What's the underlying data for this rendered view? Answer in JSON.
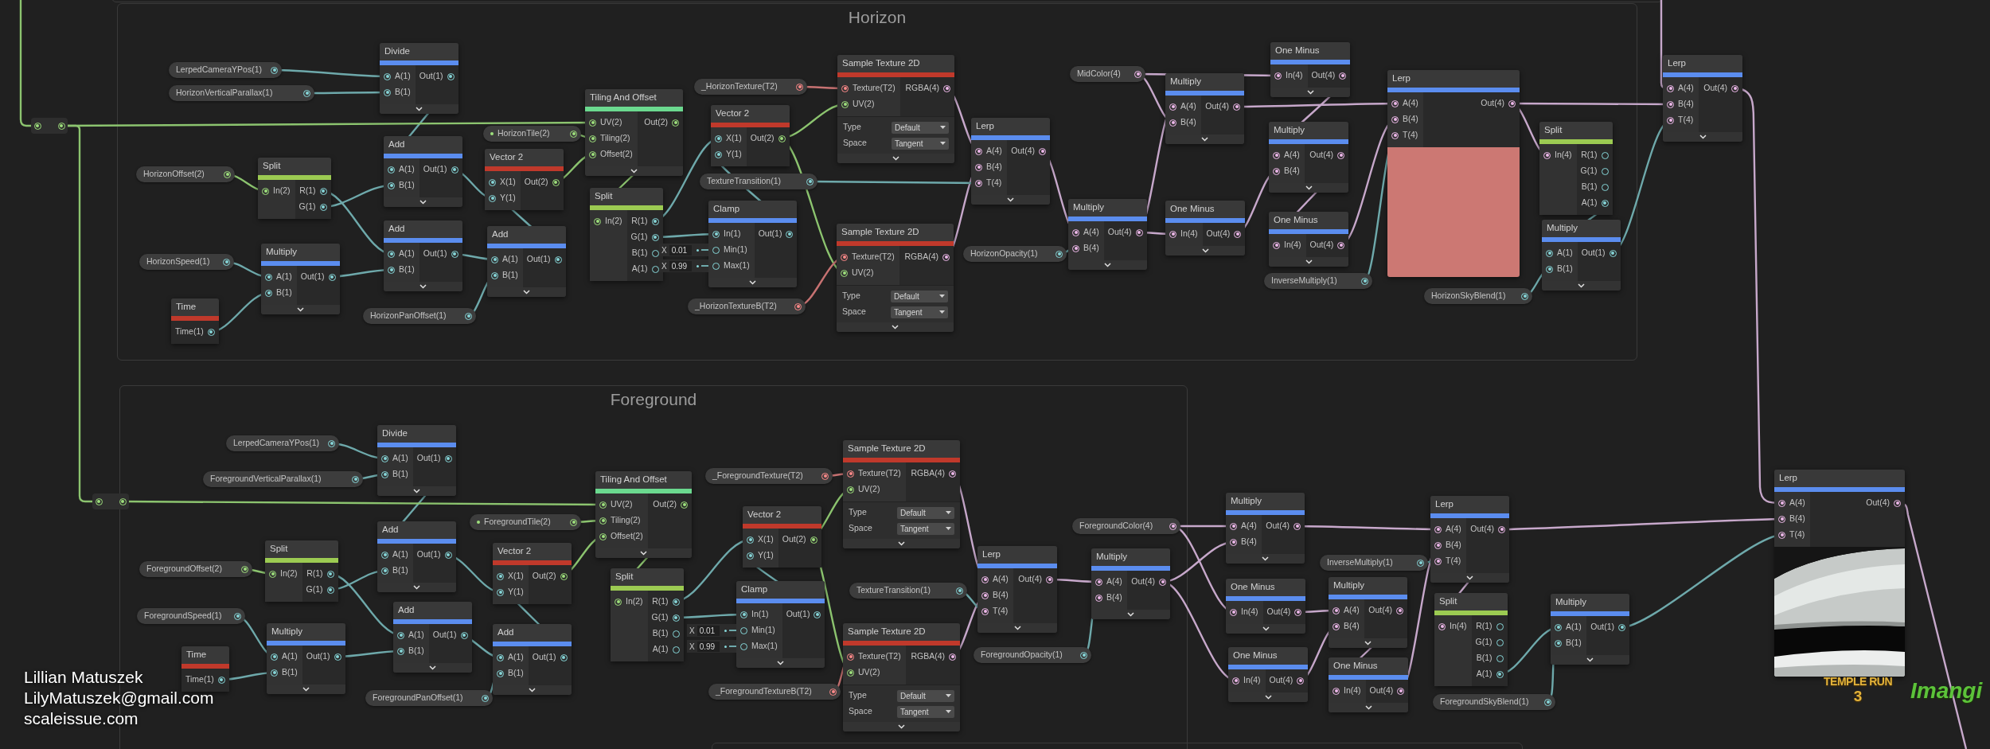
{
  "groups": [
    {
      "title": "Horizon"
    },
    {
      "title": "Foreground"
    }
  ],
  "properties": [
    {
      "label": "LerpedCameraYPos(1)",
      "kind": "float",
      "pinned": false
    },
    {
      "label": "HorizonVerticalParallax(1)",
      "kind": "float",
      "pinned": false
    },
    {
      "label": "HorizonOffset(2)",
      "kind": "vector2",
      "pinned": false
    },
    {
      "label": "HorizonSpeed(1)",
      "kind": "float",
      "pinned": false
    },
    {
      "label": "HorizonTile(2)",
      "kind": "vector2",
      "pinned": true
    },
    {
      "label": "HorizonPanOffset(1)",
      "kind": "float",
      "pinned": false
    },
    {
      "label": "_HorizonTexture(T2)",
      "kind": "texture",
      "pinned": false
    },
    {
      "label": "TextureTransition(1)",
      "kind": "float",
      "pinned": false
    },
    {
      "label": "_HorizonTextureB(T2)",
      "kind": "texture",
      "pinned": false
    },
    {
      "label": "HorizonOpacity(1)",
      "kind": "float",
      "pinned": false
    },
    {
      "label": "MidColor(4)",
      "kind": "vector4",
      "pinned": false
    },
    {
      "label": "InverseMultiply(1)",
      "kind": "float",
      "pinned": false
    },
    {
      "label": "HorizonSkyBlend(1)",
      "kind": "float",
      "pinned": false
    },
    {
      "label": "LerpedCameraYPos(1)",
      "kind": "float",
      "pinned": false
    },
    {
      "label": "ForegroundVerticalParallax(1)",
      "kind": "float",
      "pinned": false
    },
    {
      "label": "ForegroundOffset(2)",
      "kind": "vector2",
      "pinned": false
    },
    {
      "label": "ForegroundSpeed(1)",
      "kind": "float",
      "pinned": false
    },
    {
      "label": "ForegroundTile(2)",
      "kind": "vector2",
      "pinned": true
    },
    {
      "label": "ForegroundPanOffset(1)",
      "kind": "float",
      "pinned": false
    },
    {
      "label": "_ForegroundTexture(T2)",
      "kind": "texture",
      "pinned": false
    },
    {
      "label": "TextureTransition(1)",
      "kind": "float",
      "pinned": false
    },
    {
      "label": "_ForegroundTextureB(T2)",
      "kind": "texture",
      "pinned": false
    },
    {
      "label": "ForegroundOpacity(1)",
      "kind": "float",
      "pinned": false
    },
    {
      "label": "ForegroundColor(4)",
      "kind": "vector4",
      "pinned": false
    },
    {
      "label": "InverseMultiply(1)",
      "kind": "float",
      "pinned": false
    },
    {
      "label": "ForegroundSkyBlend(1)",
      "kind": "float",
      "pinned": false
    }
  ],
  "nodes": [
    {
      "title": "Divide",
      "color": "#5b8def",
      "collapsible": true,
      "inputs": [
        {
          "label": "A(1)",
          "kind": "float",
          "connected": true
        },
        {
          "label": "B(1)",
          "kind": "float",
          "connected": true
        }
      ],
      "outputs": [
        {
          "label": "Out(1)",
          "kind": "float",
          "connected": true
        }
      ]
    },
    {
      "title": "Tiling And Offset",
      "color": "#6bd98f",
      "collapsible": true,
      "inputs": [
        {
          "label": "UV(2)",
          "kind": "vector2",
          "connected": true
        },
        {
          "label": "Tiling(2)",
          "kind": "vector2",
          "connected": true
        },
        {
          "label": "Offset(2)",
          "kind": "vector2",
          "connected": true
        }
      ],
      "outputs": [
        {
          "label": "Out(2)",
          "kind": "vector2",
          "connected": true
        }
      ]
    },
    {
      "title": "Split",
      "color": "#9ccb52",
      "collapsible": false,
      "inputs": [
        {
          "label": "In(2)",
          "kind": "vector2",
          "connected": true
        }
      ],
      "outputs": [
        {
          "label": "R(1)",
          "kind": "float",
          "connected": true
        },
        {
          "label": "G(1)",
          "kind": "float",
          "connected": true
        }
      ]
    },
    {
      "title": "Add",
      "color": "#5b8def",
      "collapsible": true,
      "inputs": [
        {
          "label": "A(1)",
          "kind": "float",
          "connected": true
        },
        {
          "label": "B(1)",
          "kind": "float",
          "connected": true
        }
      ],
      "outputs": [
        {
          "label": "Out(1)",
          "kind": "float",
          "connected": true
        }
      ]
    },
    {
      "title": "Vector 2",
      "color": "#c0392b",
      "collapsible": false,
      "inputs": [
        {
          "label": "X(1)",
          "kind": "float",
          "connected": true
        },
        {
          "label": "Y(1)",
          "kind": "float",
          "connected": true
        }
      ],
      "outputs": [
        {
          "label": "Out(2)",
          "kind": "vector2",
          "connected": true
        }
      ]
    },
    {
      "title": "Add",
      "color": "#5b8def",
      "collapsible": true,
      "inputs": [
        {
          "label": "A(1)",
          "kind": "float",
          "connected": true
        },
        {
          "label": "B(1)",
          "kind": "float",
          "connected": true
        }
      ],
      "outputs": [
        {
          "label": "Out(1)",
          "kind": "float",
          "connected": true
        }
      ]
    },
    {
      "title": "Add",
      "color": "#5b8def",
      "collapsible": true,
      "inputs": [
        {
          "label": "A(1)",
          "kind": "float",
          "connected": true
        },
        {
          "label": "B(1)",
          "kind": "float",
          "connected": true
        }
      ],
      "outputs": [
        {
          "label": "Out(1)",
          "kind": "float",
          "connected": true
        }
      ]
    },
    {
      "title": "Multiply",
      "color": "#5b8def",
      "collapsible": true,
      "inputs": [
        {
          "label": "A(1)",
          "kind": "float",
          "connected": true
        },
        {
          "label": "B(1)",
          "kind": "float",
          "connected": true
        }
      ],
      "outputs": [
        {
          "label": "Out(1)",
          "kind": "float",
          "connected": true
        }
      ]
    },
    {
      "title": "Time",
      "color": "#c0392b",
      "collapsible": false,
      "outputs": [
        {
          "label": "Time(1)",
          "kind": "float",
          "connected": true
        }
      ]
    },
    {
      "title": "Split",
      "color": "#9ccb52",
      "collapsible": false,
      "inputs": [
        {
          "label": "In(2)",
          "kind": "vector2",
          "connected": true
        }
      ],
      "outputs": [
        {
          "label": "R(1)",
          "kind": "float",
          "connected": true
        },
        {
          "label": "G(1)",
          "kind": "float",
          "connected": true
        },
        {
          "label": "B(1)",
          "kind": "float",
          "connected": false
        },
        {
          "label": "A(1)",
          "kind": "float",
          "connected": false
        }
      ]
    },
    {
      "title": "Vector 2",
      "color": "#c0392b",
      "collapsible": false,
      "inputs": [
        {
          "label": "X(1)",
          "kind": "float",
          "connected": true
        },
        {
          "label": "Y(1)",
          "kind": "float",
          "connected": true
        }
      ],
      "outputs": [
        {
          "label": "Out(2)",
          "kind": "vector2",
          "connected": true
        }
      ]
    },
    {
      "title": "Clamp",
      "color": "#5b8def",
      "collapsible": true,
      "inputs": [
        {
          "label": "In(1)",
          "kind": "float",
          "connected": true
        },
        {
          "label": "Min(1)",
          "kind": "float",
          "connected": false,
          "field": {
            "axis": "X",
            "value": "0.01"
          }
        },
        {
          "label": "Max(1)",
          "kind": "float",
          "connected": false,
          "field": {
            "axis": "X",
            "value": "0.99"
          }
        }
      ],
      "outputs": [
        {
          "label": "Out(1)",
          "kind": "float",
          "connected": true
        }
      ]
    },
    {
      "title": "Sample Texture 2D",
      "color": "#c0392b",
      "collapsible": true,
      "inputs": [
        {
          "label": "Texture(T2)",
          "kind": "texture",
          "connected": true
        },
        {
          "label": "UV(2)",
          "kind": "vector2",
          "connected": true
        }
      ],
      "outputs": [
        {
          "label": "RGBA(4)",
          "kind": "vector4",
          "connected": true
        }
      ],
      "controls": [
        {
          "label": "Type",
          "value": "Default"
        },
        {
          "label": "Space",
          "value": "Tangent"
        }
      ]
    },
    {
      "title": "Sample Texture 2D",
      "color": "#c0392b",
      "collapsible": true,
      "inputs": [
        {
          "label": "Texture(T2)",
          "kind": "texture",
          "connected": true
        },
        {
          "label": "UV(2)",
          "kind": "vector2",
          "connected": true
        }
      ],
      "outputs": [
        {
          "label": "RGBA(4)",
          "kind": "vector4",
          "connected": true
        }
      ],
      "controls": [
        {
          "label": "Type",
          "value": "Default"
        },
        {
          "label": "Space",
          "value": "Tangent"
        }
      ]
    },
    {
      "title": "Lerp",
      "color": "#5b8def",
      "collapsible": true,
      "inputs": [
        {
          "label": "A(4)",
          "kind": "vector4",
          "connected": true
        },
        {
          "label": "B(4)",
          "kind": "vector4",
          "connected": true
        },
        {
          "label": "T(4)",
          "kind": "vector4",
          "connected": true
        }
      ],
      "outputs": [
        {
          "label": "Out(4)",
          "kind": "vector4",
          "connected": true
        }
      ]
    },
    {
      "title": "Multiply",
      "color": "#5b8def",
      "collapsible": true,
      "inputs": [
        {
          "label": "A(4)",
          "kind": "vector4",
          "connected": true
        },
        {
          "label": "B(4)",
          "kind": "vector4",
          "connected": true
        }
      ],
      "outputs": [
        {
          "label": "Out(4)",
          "kind": "vector4",
          "connected": true
        }
      ]
    },
    {
      "title": "Multiply",
      "color": "#5b8def",
      "collapsible": true,
      "inputs": [
        {
          "label": "A(4)",
          "kind": "vector4",
          "connected": true
        },
        {
          "label": "B(4)",
          "kind": "vector4",
          "connected": true
        }
      ],
      "outputs": [
        {
          "label": "Out(4)",
          "kind": "vector4",
          "connected": true
        }
      ]
    },
    {
      "title": "One Minus",
      "color": "#5b8def",
      "collapsible": true,
      "inputs": [
        {
          "label": "In(4)",
          "kind": "vector4",
          "connected": true
        }
      ],
      "outputs": [
        {
          "label": "Out(4)",
          "kind": "vector4",
          "connected": true
        }
      ]
    },
    {
      "title": "Multiply",
      "color": "#5b8def",
      "collapsible": true,
      "inputs": [
        {
          "label": "A(4)",
          "kind": "vector4",
          "connected": true
        },
        {
          "label": "B(4)",
          "kind": "vector4",
          "connected": true
        }
      ],
      "outputs": [
        {
          "label": "Out(4)",
          "kind": "vector4",
          "connected": true
        }
      ]
    },
    {
      "title": "One Minus",
      "color": "#5b8def",
      "collapsible": true,
      "inputs": [
        {
          "label": "In(4)",
          "kind": "vector4",
          "connected": true
        }
      ],
      "outputs": [
        {
          "label": "Out(4)",
          "kind": "vector4",
          "connected": true
        }
      ]
    },
    {
      "title": "One Minus",
      "color": "#5b8def",
      "collapsible": true,
      "inputs": [
        {
          "label": "In(4)",
          "kind": "vector4",
          "connected": true
        }
      ],
      "outputs": [
        {
          "label": "Out(4)",
          "kind": "vector4",
          "connected": true
        }
      ]
    },
    {
      "title": "Lerp",
      "color": "#5b8def",
      "collapsible": false,
      "inputs": [
        {
          "label": "A(4)",
          "kind": "vector4",
          "connected": true
        },
        {
          "label": "B(4)",
          "kind": "vector4",
          "connected": true
        },
        {
          "label": "T(4)",
          "kind": "vector4",
          "connected": true
        }
      ],
      "outputs": [
        {
          "label": "Out(4)",
          "kind": "vector4",
          "connected": true
        }
      ],
      "preview": {
        "kind": "swatch",
        "color": "#cc7873"
      }
    },
    {
      "title": "Split",
      "color": "#9ccb52",
      "collapsible": false,
      "inputs": [
        {
          "label": "In(4)",
          "kind": "vector4",
          "connected": true
        }
      ],
      "outputs": [
        {
          "label": "R(1)",
          "kind": "float",
          "connected": false
        },
        {
          "label": "G(1)",
          "kind": "float",
          "connected": false
        },
        {
          "label": "B(1)",
          "kind": "float",
          "connected": false
        },
        {
          "label": "A(1)",
          "kind": "float",
          "connected": true
        }
      ]
    },
    {
      "title": "Multiply",
      "color": "#5b8def",
      "collapsible": true,
      "inputs": [
        {
          "label": "A(1)",
          "kind": "float",
          "connected": true
        },
        {
          "label": "B(1)",
          "kind": "float",
          "connected": true
        }
      ],
      "outputs": [
        {
          "label": "Out(1)",
          "kind": "float",
          "connected": true
        }
      ]
    },
    {
      "title": "Lerp",
      "color": "#5b8def",
      "collapsible": true,
      "inputs": [
        {
          "label": "A(4)",
          "kind": "vector4",
          "connected": true
        },
        {
          "label": "B(4)",
          "kind": "vector4",
          "connected": true
        },
        {
          "label": "T(4)",
          "kind": "vector4",
          "connected": true
        }
      ],
      "outputs": [
        {
          "label": "Out(4)",
          "kind": "vector4",
          "connected": true
        }
      ]
    },
    {
      "title": "Divide",
      "color": "#5b8def",
      "collapsible": true,
      "inputs": [
        {
          "label": "A(1)",
          "kind": "float",
          "connected": true
        },
        {
          "label": "B(1)",
          "kind": "float",
          "connected": true
        }
      ],
      "outputs": [
        {
          "label": "Out(1)",
          "kind": "float",
          "connected": true
        }
      ]
    },
    {
      "title": "Tiling And Offset",
      "color": "#6bd98f",
      "collapsible": true,
      "inputs": [
        {
          "label": "UV(2)",
          "kind": "vector2",
          "connected": true
        },
        {
          "label": "Tiling(2)",
          "kind": "vector2",
          "connected": true
        },
        {
          "label": "Offset(2)",
          "kind": "vector2",
          "connected": true
        }
      ],
      "outputs": [
        {
          "label": "Out(2)",
          "kind": "vector2",
          "connected": true
        }
      ]
    },
    {
      "title": "Split",
      "color": "#9ccb52",
      "collapsible": false,
      "inputs": [
        {
          "label": "In(2)",
          "kind": "vector2",
          "connected": true
        }
      ],
      "outputs": [
        {
          "label": "R(1)",
          "kind": "float",
          "connected": true
        },
        {
          "label": "G(1)",
          "kind": "float",
          "connected": true
        }
      ]
    },
    {
      "title": "Add",
      "color": "#5b8def",
      "collapsible": true,
      "inputs": [
        {
          "label": "A(1)",
          "kind": "float",
          "connected": true
        },
        {
          "label": "B(1)",
          "kind": "float",
          "connected": true
        }
      ],
      "outputs": [
        {
          "label": "Out(1)",
          "kind": "float",
          "connected": true
        }
      ]
    },
    {
      "title": "Vector 2",
      "color": "#c0392b",
      "collapsible": false,
      "inputs": [
        {
          "label": "X(1)",
          "kind": "float",
          "connected": true
        },
        {
          "label": "Y(1)",
          "kind": "float",
          "connected": true
        }
      ],
      "outputs": [
        {
          "label": "Out(2)",
          "kind": "vector2",
          "connected": true
        }
      ]
    },
    {
      "title": "Add",
      "color": "#5b8def",
      "collapsible": true,
      "inputs": [
        {
          "label": "A(1)",
          "kind": "float",
          "connected": true
        },
        {
          "label": "B(1)",
          "kind": "float",
          "connected": true
        }
      ],
      "outputs": [
        {
          "label": "Out(1)",
          "kind": "float",
          "connected": true
        }
      ]
    },
    {
      "title": "Multiply",
      "color": "#5b8def",
      "collapsible": true,
      "inputs": [
        {
          "label": "A(1)",
          "kind": "float",
          "connected": true
        },
        {
          "label": "B(1)",
          "kind": "float",
          "connected": true
        }
      ],
      "outputs": [
        {
          "label": "Out(1)",
          "kind": "float",
          "connected": true
        }
      ]
    },
    {
      "title": "Add",
      "color": "#5b8def",
      "collapsible": true,
      "inputs": [
        {
          "label": "A(1)",
          "kind": "float",
          "connected": true
        },
        {
          "label": "B(1)",
          "kind": "float",
          "connected": true
        }
      ],
      "outputs": [
        {
          "label": "Out(1)",
          "kind": "float",
          "connected": true
        }
      ]
    },
    {
      "title": "Time",
      "color": "#c0392b",
      "collapsible": false,
      "outputs": [
        {
          "label": "Time(1)",
          "kind": "float",
          "connected": true
        }
      ]
    },
    {
      "title": "Split",
      "color": "#9ccb52",
      "collapsible": false,
      "inputs": [
        {
          "label": "In(2)",
          "kind": "vector2",
          "connected": true
        }
      ],
      "outputs": [
        {
          "label": "R(1)",
          "kind": "float",
          "connected": true
        },
        {
          "label": "G(1)",
          "kind": "float",
          "connected": true
        },
        {
          "label": "B(1)",
          "kind": "float",
          "connected": false
        },
        {
          "label": "A(1)",
          "kind": "float",
          "connected": false
        }
      ]
    },
    {
      "title": "Vector 2",
      "color": "#c0392b",
      "collapsible": false,
      "inputs": [
        {
          "label": "X(1)",
          "kind": "float",
          "connected": true
        },
        {
          "label": "Y(1)",
          "kind": "float",
          "connected": true
        }
      ],
      "outputs": [
        {
          "label": "Out(2)",
          "kind": "vector2",
          "connected": true
        }
      ]
    },
    {
      "title": "Clamp",
      "color": "#5b8def",
      "collapsible": true,
      "inputs": [
        {
          "label": "In(1)",
          "kind": "float",
          "connected": true
        },
        {
          "label": "Min(1)",
          "kind": "float",
          "connected": false,
          "field": {
            "axis": "X",
            "value": "0.01"
          }
        },
        {
          "label": "Max(1)",
          "kind": "float",
          "connected": false,
          "field": {
            "axis": "X",
            "value": "0.99"
          }
        }
      ],
      "outputs": [
        {
          "label": "Out(1)",
          "kind": "float",
          "connected": true
        }
      ]
    },
    {
      "title": "Sample Texture 2D",
      "color": "#c0392b",
      "collapsible": true,
      "inputs": [
        {
          "label": "Texture(T2)",
          "kind": "texture",
          "connected": true
        },
        {
          "label": "UV(2)",
          "kind": "vector2",
          "connected": true
        }
      ],
      "outputs": [
        {
          "label": "RGBA(4)",
          "kind": "vector4",
          "connected": true
        }
      ],
      "controls": [
        {
          "label": "Type",
          "value": "Default"
        },
        {
          "label": "Space",
          "value": "Tangent"
        }
      ]
    },
    {
      "title": "Sample Texture 2D",
      "color": "#c0392b",
      "collapsible": true,
      "inputs": [
        {
          "label": "Texture(T2)",
          "kind": "texture",
          "connected": true
        },
        {
          "label": "UV(2)",
          "kind": "vector2",
          "connected": true
        }
      ],
      "outputs": [
        {
          "label": "RGBA(4)",
          "kind": "vector4",
          "connected": true
        }
      ],
      "controls": [
        {
          "label": "Type",
          "value": "Default"
        },
        {
          "label": "Space",
          "value": "Tangent"
        }
      ]
    },
    {
      "title": "Lerp",
      "color": "#5b8def",
      "collapsible": true,
      "inputs": [
        {
          "label": "A(4)",
          "kind": "vector4",
          "connected": true
        },
        {
          "label": "B(4)",
          "kind": "vector4",
          "connected": true
        },
        {
          "label": "T(4)",
          "kind": "vector4",
          "connected": true
        }
      ],
      "outputs": [
        {
          "label": "Out(4)",
          "kind": "vector4",
          "connected": true
        }
      ]
    },
    {
      "title": "Multiply",
      "color": "#5b8def",
      "collapsible": true,
      "inputs": [
        {
          "label": "A(4)",
          "kind": "vector4",
          "connected": true
        },
        {
          "label": "B(4)",
          "kind": "vector4",
          "connected": true
        }
      ],
      "outputs": [
        {
          "label": "Out(4)",
          "kind": "vector4",
          "connected": true
        }
      ]
    },
    {
      "title": "Multiply",
      "color": "#5b8def",
      "collapsible": true,
      "inputs": [
        {
          "label": "A(4)",
          "kind": "vector4",
          "connected": true
        },
        {
          "label": "B(4)",
          "kind": "vector4",
          "connected": true
        }
      ],
      "outputs": [
        {
          "label": "Out(4)",
          "kind": "vector4",
          "connected": true
        }
      ]
    },
    {
      "title": "One Minus",
      "color": "#5b8def",
      "collapsible": true,
      "inputs": [
        {
          "label": "In(4)",
          "kind": "vector4",
          "connected": true
        }
      ],
      "outputs": [
        {
          "label": "Out(4)",
          "kind": "vector4",
          "connected": true
        }
      ]
    },
    {
      "title": "One Minus",
      "color": "#5b8def",
      "collapsible": true,
      "inputs": [
        {
          "label": "In(4)",
          "kind": "vector4",
          "connected": true
        }
      ],
      "outputs": [
        {
          "label": "Out(4)",
          "kind": "vector4",
          "connected": true
        }
      ]
    },
    {
      "title": "Multiply",
      "color": "#5b8def",
      "collapsible": true,
      "inputs": [
        {
          "label": "A(4)",
          "kind": "vector4",
          "connected": true
        },
        {
          "label": "B(4)",
          "kind": "vector4",
          "connected": true
        }
      ],
      "outputs": [
        {
          "label": "Out(4)",
          "kind": "vector4",
          "connected": true
        }
      ]
    },
    {
      "title": "One Minus",
      "color": "#5b8def",
      "collapsible": true,
      "inputs": [
        {
          "label": "In(4)",
          "kind": "vector4",
          "connected": true
        }
      ],
      "outputs": [
        {
          "label": "Out(4)",
          "kind": "vector4",
          "connected": true
        }
      ]
    },
    {
      "title": "Lerp",
      "color": "#5b8def",
      "collapsible": true,
      "inputs": [
        {
          "label": "A(4)",
          "kind": "vector4",
          "connected": true
        },
        {
          "label": "B(4)",
          "kind": "vector4",
          "connected": true
        },
        {
          "label": "T(4)",
          "kind": "vector4",
          "connected": true
        }
      ],
      "outputs": [
        {
          "label": "Out(4)",
          "kind": "vector4",
          "connected": true
        }
      ]
    },
    {
      "title": "Split",
      "color": "#9ccb52",
      "collapsible": false,
      "inputs": [
        {
          "label": "In(4)",
          "kind": "vector4",
          "connected": true
        }
      ],
      "outputs": [
        {
          "label": "R(1)",
          "kind": "float",
          "connected": false
        },
        {
          "label": "G(1)",
          "kind": "float",
          "connected": false
        },
        {
          "label": "B(1)",
          "kind": "float",
          "connected": false
        },
        {
          "label": "A(1)",
          "kind": "float",
          "connected": true
        }
      ]
    },
    {
      "title": "Multiply",
      "color": "#5b8def",
      "collapsible": true,
      "inputs": [
        {
          "label": "A(1)",
          "kind": "float",
          "connected": true
        },
        {
          "label": "B(1)",
          "kind": "float",
          "connected": true
        }
      ],
      "outputs": [
        {
          "label": "Out(1)",
          "kind": "float",
          "connected": true
        }
      ]
    },
    {
      "title": "Lerp",
      "color": "#5b8def",
      "collapsible": false,
      "inputs": [
        {
          "label": "A(4)",
          "kind": "vector4",
          "connected": true
        },
        {
          "label": "B(4)",
          "kind": "vector4",
          "connected": true
        },
        {
          "label": "T(4)",
          "kind": "vector4",
          "connected": true
        }
      ],
      "outputs": [
        {
          "label": "Out(4)",
          "kind": "vector4",
          "connected": true
        }
      ],
      "preview": {
        "kind": "picture"
      }
    }
  ],
  "credits": [
    "Lillian Matuszek",
    "LilyMatuszek@gmail.com",
    "scaleissue.com"
  ],
  "logos": {
    "game": [
      "TEMPLE RUN",
      "3"
    ],
    "studio": "Imangi"
  }
}
